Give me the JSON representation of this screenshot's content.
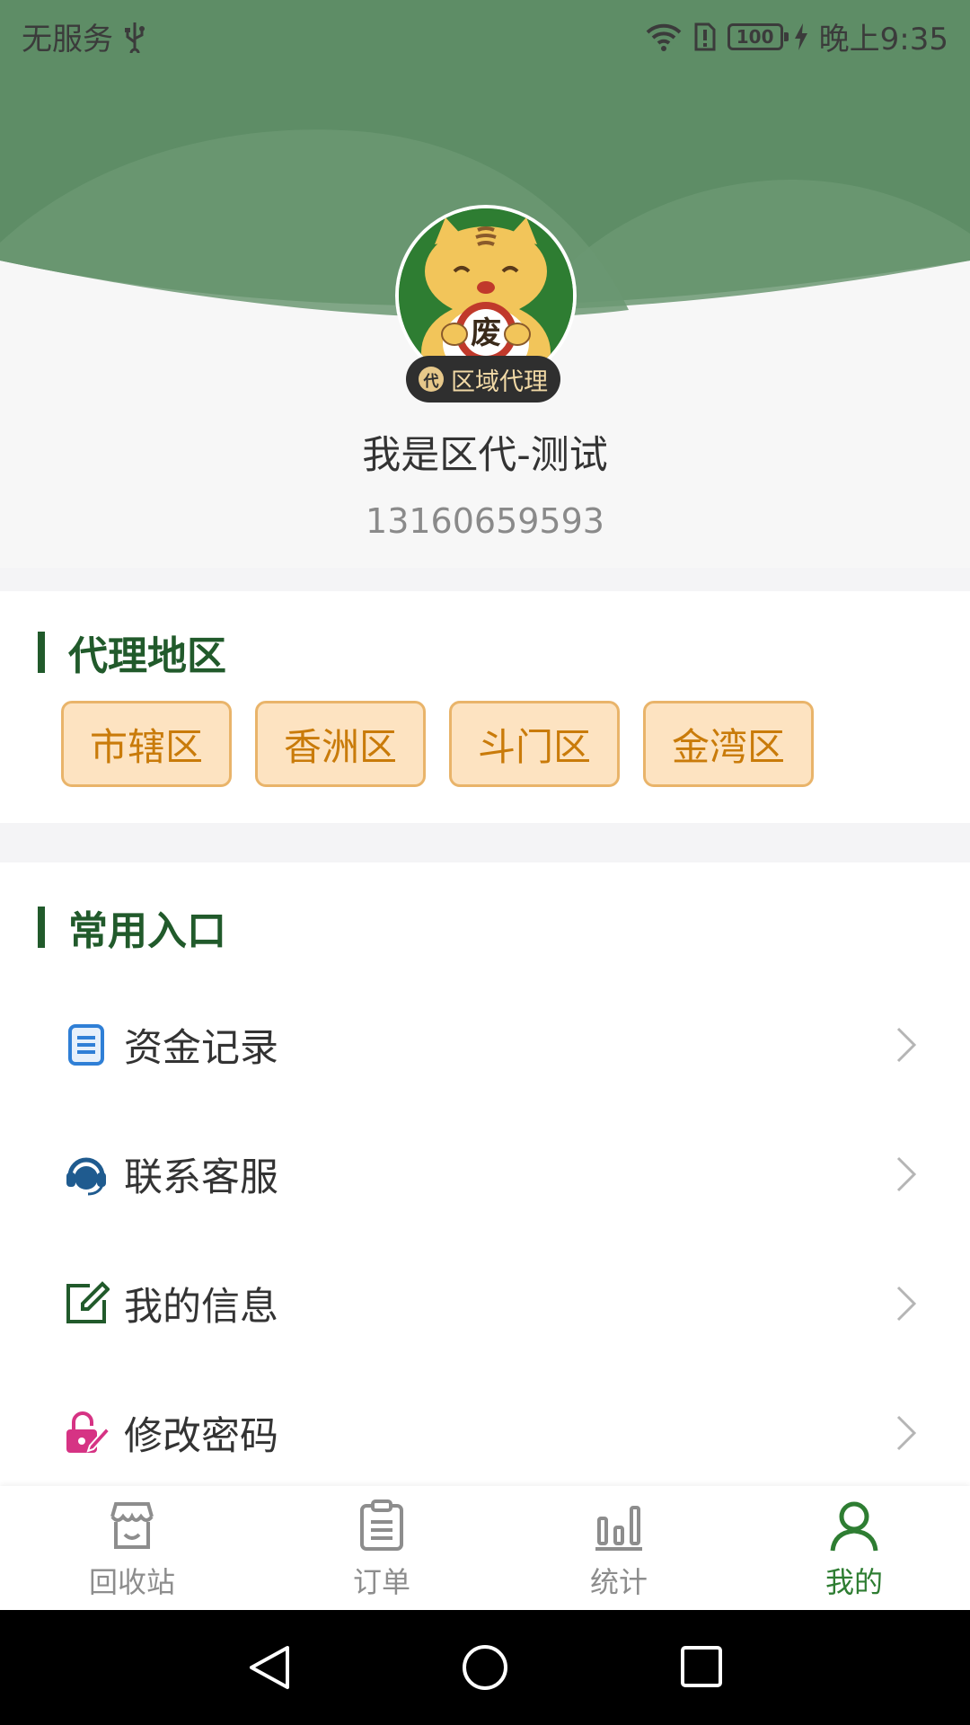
{
  "status_bar": {
    "carrier": "无服务",
    "battery": "100",
    "time": "晚上9:35"
  },
  "profile": {
    "badge": "区域代理",
    "badge_icon_text": "代",
    "name": "我是区代-测试",
    "phone": "13160659593",
    "avatar_char": "废"
  },
  "regions": {
    "title": "代理地区",
    "items": [
      "市辖区",
      "香洲区",
      "斗门区",
      "金湾区"
    ]
  },
  "shortcuts": {
    "title": "常用入口",
    "items": [
      {
        "label": "资金记录",
        "icon": "document-list-icon"
      },
      {
        "label": "联系客服",
        "icon": "headset-icon"
      },
      {
        "label": "我的信息",
        "icon": "edit-icon"
      },
      {
        "label": "修改密码",
        "icon": "lock-edit-icon"
      }
    ]
  },
  "tabbar": {
    "items": [
      {
        "label": "回收站",
        "icon": "store-icon"
      },
      {
        "label": "订单",
        "icon": "clipboard-icon"
      },
      {
        "label": "统计",
        "icon": "bar-chart-icon"
      },
      {
        "label": "我的",
        "icon": "person-icon"
      }
    ],
    "active": "我的"
  },
  "colors": {
    "header_green": "#5e8d66",
    "accent": "#215a2b",
    "chip_bg": "#fde3c1",
    "chip_text": "#c97b0a",
    "active_tab": "#2e7d32"
  }
}
